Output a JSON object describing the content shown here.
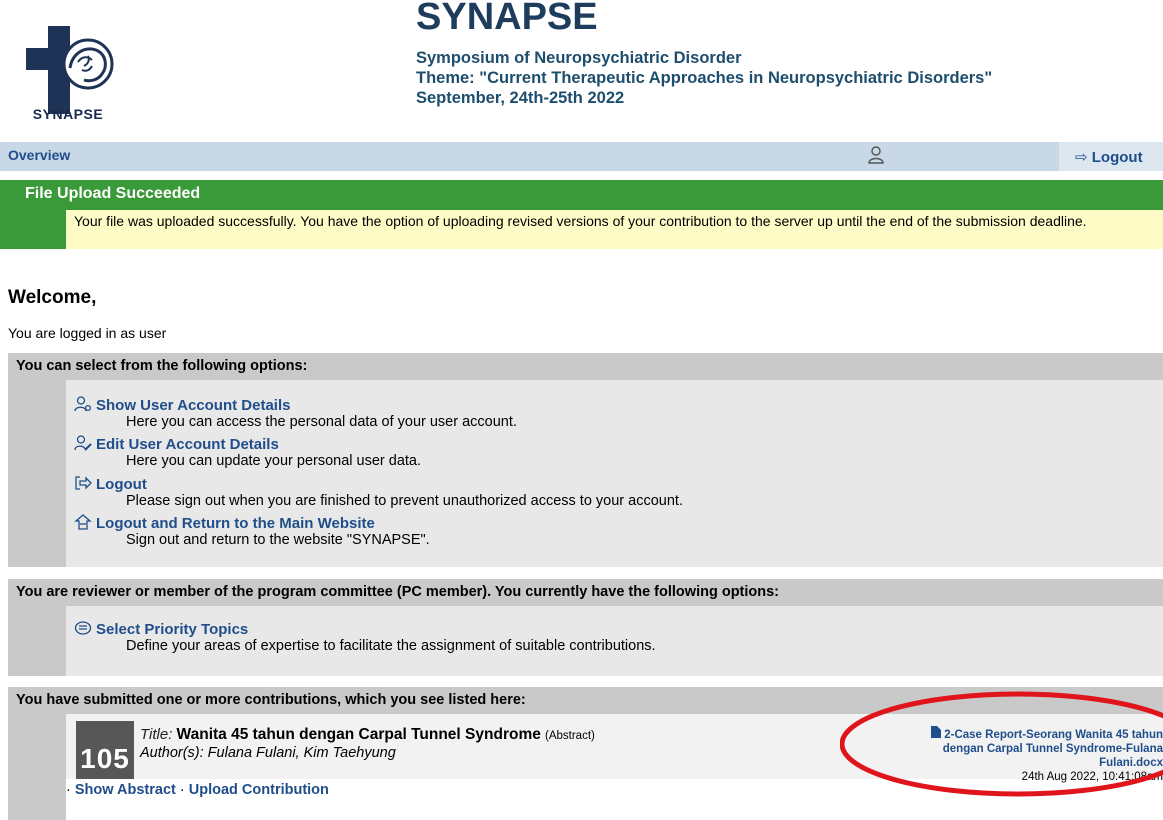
{
  "header": {
    "logo_text": "SYNAPSE",
    "title": "SYNAPSE",
    "subtitle_lines": [
      "Symposium of Neuropsychiatric Disorder",
      "Theme: \"Current Therapeutic Approaches in Neuropsychiatric Disorders\"",
      "September, 24th-25th 2022"
    ]
  },
  "nav": {
    "overview": "Overview",
    "logout": "Logout"
  },
  "notice": {
    "title": "File Upload Succeeded",
    "message": "Your file was uploaded successfully. You have the option of uploading revised versions of your contribution to the server up until the end of the submission deadline."
  },
  "welcome": {
    "heading": "Welcome,",
    "logged_in_text": "You are logged in as user"
  },
  "section_options": {
    "heading": "You can select from the following options:",
    "items": [
      {
        "title": "Show User Account Details",
        "desc": "Here you can access the personal data of your user account."
      },
      {
        "title": "Edit User Account Details",
        "desc": "Here you can update your personal user data."
      },
      {
        "title": "Logout",
        "desc": "Please sign out when you are finished to prevent unauthorized access to your account."
      },
      {
        "title": "Logout and Return to the Main Website",
        "desc": "Sign out and return to the website \"SYNAPSE\"."
      }
    ]
  },
  "section_pc": {
    "heading": "You are reviewer or member of the program committee (PC member). You currently have the following options:",
    "items": [
      {
        "title": "Select Priority Topics",
        "desc": "Define your areas of expertise to facilitate the assignment of suitable contributions."
      }
    ]
  },
  "section_submissions": {
    "heading": "You have submitted one or more contributions, which you see listed here:",
    "contribution": {
      "id": "105",
      "title_label": "Title:",
      "title": "Wanita 45 tahun dengan Carpal Tunnel Syndrome",
      "type": "(Abstract)",
      "authors": "Author(s): Fulana Fulani, Kim Taehyung",
      "file_name": "2-Case Report-Seorang Wanita 45 tahun dengan Carpal Tunnel Syndrome-Fulana Fulani.docx",
      "file_date": "24th Aug 2022, 10:41:08am",
      "action_sep": "·",
      "actions": [
        "Show Abstract",
        "Upload Contribution"
      ]
    }
  },
  "colors": {
    "accent": "#1f4e8a",
    "success": "#3a9a3a",
    "notice_bg": "#fdfbc6",
    "highlight": "#e0141b"
  }
}
